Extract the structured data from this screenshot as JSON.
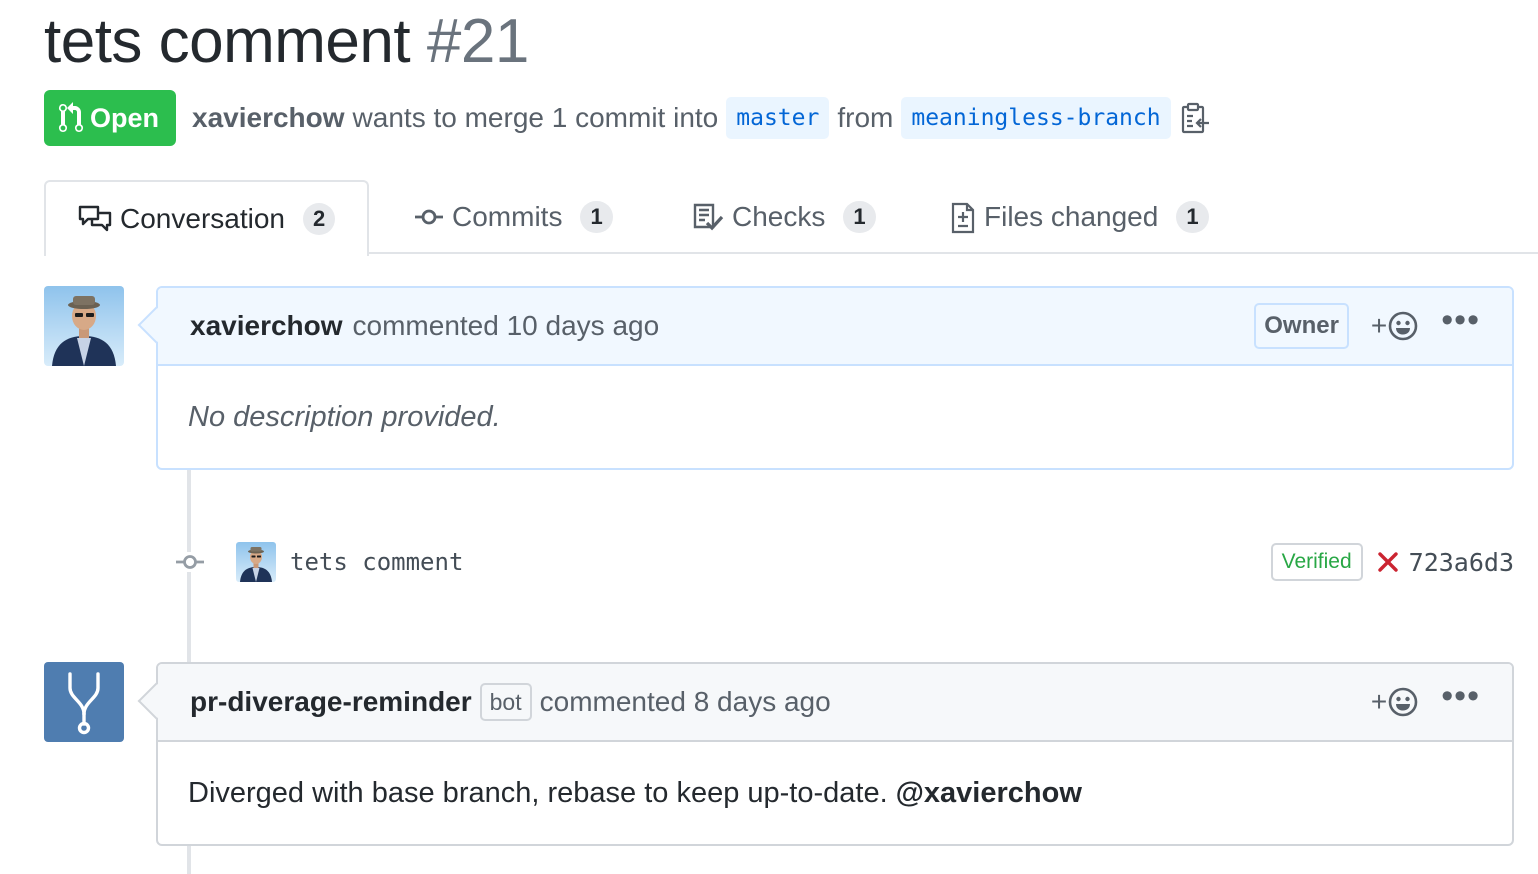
{
  "pr": {
    "title": "tets comment",
    "number": "#21",
    "state": "Open",
    "author": "xavierchow",
    "merge_text": "wants to merge 1 commit into",
    "base_branch": "master",
    "from_text": "from",
    "head_branch": "meaningless-branch"
  },
  "tabs": [
    {
      "label": "Conversation",
      "count": "2",
      "icon": "comment-discussion-icon",
      "selected": true
    },
    {
      "label": "Commits",
      "count": "1",
      "icon": "git-commit-icon"
    },
    {
      "label": "Checks",
      "count": "1",
      "icon": "checklist-icon"
    },
    {
      "label": "Files changed",
      "count": "1",
      "icon": "diff-icon"
    }
  ],
  "comments": [
    {
      "author": "xavierchow",
      "action": "commented 10 days ago",
      "role": "Owner",
      "body": "No description provided.",
      "reaction": "+",
      "menu": "•••"
    },
    {
      "author": "pr-diverage-reminder",
      "badge": "bot",
      "action": "commented 8 days ago",
      "body": "Diverged with base branch, rebase to keep up-to-date.",
      "mention": "@xavierchow",
      "reaction": "+",
      "menu": "•••"
    }
  ],
  "commit": {
    "message": "tets comment",
    "verified": "Verified",
    "status": "failure",
    "sha": "723a6d3"
  },
  "colors": {
    "open_green": "#2cbe4e",
    "link_blue": "#0366d6",
    "owner_header": "#f1f8ff",
    "fail_red": "#cb2431",
    "verified_green": "#28a745"
  }
}
